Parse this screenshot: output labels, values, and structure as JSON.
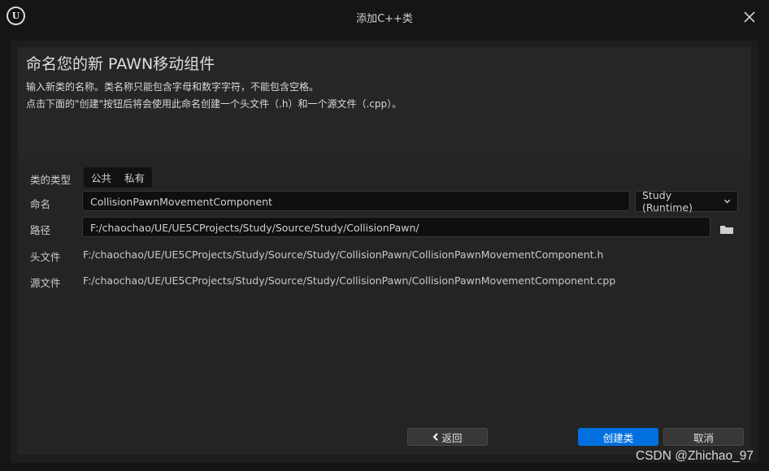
{
  "window": {
    "logo_text": "U",
    "title": "添加C++类"
  },
  "header": {
    "heading": "命名您的新 PAWN移动组件",
    "description_line1": "输入新类的名称。类名称只能包含字母和数字字符，不能包含空格。",
    "description_line2": "点击下面的\"创建\"按钮后将会使用此命名创建一个头文件（.h）和一个源文件（.cpp）。"
  },
  "form": {
    "class_type": {
      "label": "类的类型",
      "options": [
        "公共",
        "私有"
      ]
    },
    "name": {
      "label": "命名",
      "value": "CollisionPawnMovementComponent",
      "module": "Study (Runtime)"
    },
    "path": {
      "label": "路径",
      "value": "F:/chaochao/UE/UE5CProjects/Study/Source/Study/CollisionPawn/"
    },
    "header_file": {
      "label": "头文件",
      "value": "F:/chaochao/UE/UE5CProjects/Study/Source/Study/CollisionPawn/CollisionPawnMovementComponent.h"
    },
    "source_file": {
      "label": "源文件",
      "value": "F:/chaochao/UE/UE5CProjects/Study/Source/Study/CollisionPawn/CollisionPawnMovementComponent.cpp"
    }
  },
  "footer": {
    "back_label": "返回",
    "create_label": "创建类",
    "cancel_label": "取消"
  },
  "watermark": "CSDN @Zhichao_97",
  "colors": {
    "accent": "#0070e0",
    "background": "#151515",
    "panel": "#242424"
  },
  "icons": {
    "close": "close-icon",
    "folder": "folder-icon",
    "dropdown": "chevron-down-icon",
    "back": "chevron-left-icon"
  }
}
